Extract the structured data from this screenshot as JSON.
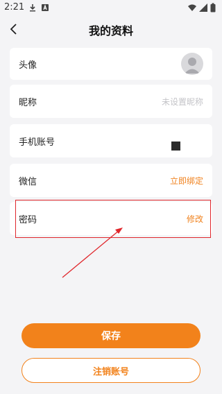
{
  "status_bar": {
    "time": "2:21",
    "icons": [
      "download-icon",
      "notification-a-icon",
      "wifi-icon",
      "signal-icon",
      "battery-icon"
    ]
  },
  "header": {
    "title": "我的资料",
    "back_icon": "back-chevron-icon"
  },
  "profile": {
    "avatar": {
      "label": "头像",
      "icon": "default-avatar-icon"
    },
    "nickname": {
      "label": "昵称",
      "placeholder": "未设置昵称"
    },
    "phone": {
      "label": "手机账号"
    },
    "wechat": {
      "label": "微信",
      "action": "立即绑定"
    },
    "password": {
      "label": "密码",
      "action": "修改"
    }
  },
  "actions": {
    "save_label": "保存",
    "cancel_account_label": "注销账号"
  },
  "colors": {
    "accent": "#f2821b",
    "annotation": "#e0262b",
    "background": "#f4f4f6"
  }
}
